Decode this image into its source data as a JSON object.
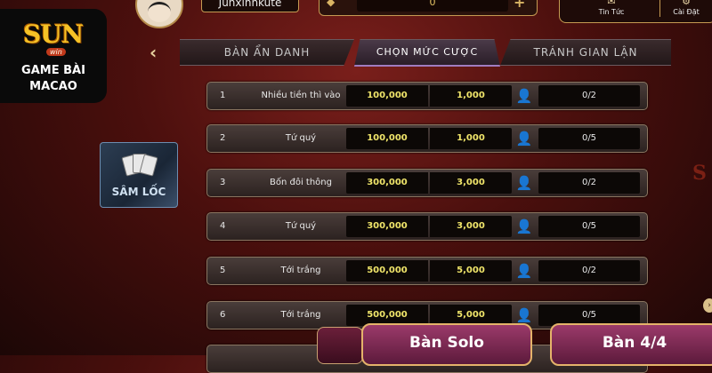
{
  "header": {
    "username": "Junxinhkute",
    "coin_amount": "0",
    "news_label": "Tin Tức",
    "settings_label": "Cài Đặt"
  },
  "logo": {
    "brand": "SUN",
    "badge": "win",
    "line1": "GAME BÀI",
    "line2": "MACAO"
  },
  "tabs": [
    {
      "label": "BÀN ẨN DANH"
    },
    {
      "label": "CHỌN MỨC CƯỢC"
    },
    {
      "label": "TRÁNH GIAN LẬN"
    }
  ],
  "game_thumb": {
    "label": "SÂM LỐC"
  },
  "rows": [
    {
      "idx": "1",
      "name": "Nhiều tiền thì vào",
      "bet": "100,000",
      "min": "1,000",
      "count": "0/2"
    },
    {
      "idx": "2",
      "name": "Tứ quý",
      "bet": "100,000",
      "min": "1,000",
      "count": "0/5"
    },
    {
      "idx": "3",
      "name": "Bốn đôi thông",
      "bet": "300,000",
      "min": "3,000",
      "count": "0/2"
    },
    {
      "idx": "4",
      "name": "Tứ quý",
      "bet": "300,000",
      "min": "3,000",
      "count": "0/5"
    },
    {
      "idx": "5",
      "name": "Tới trắng",
      "bet": "500,000",
      "min": "5,000",
      "count": "0/2"
    },
    {
      "idx": "6",
      "name": "Tới trắng",
      "bet": "500,000",
      "min": "5,000",
      "count": "0/5"
    }
  ],
  "buttons": {
    "solo": "Bàn Solo",
    "four": "Bàn 4/4"
  },
  "icons": {
    "user": "user-icon",
    "back": "back-chevron-icon",
    "news": "news-icon",
    "settings": "gear-icon"
  }
}
